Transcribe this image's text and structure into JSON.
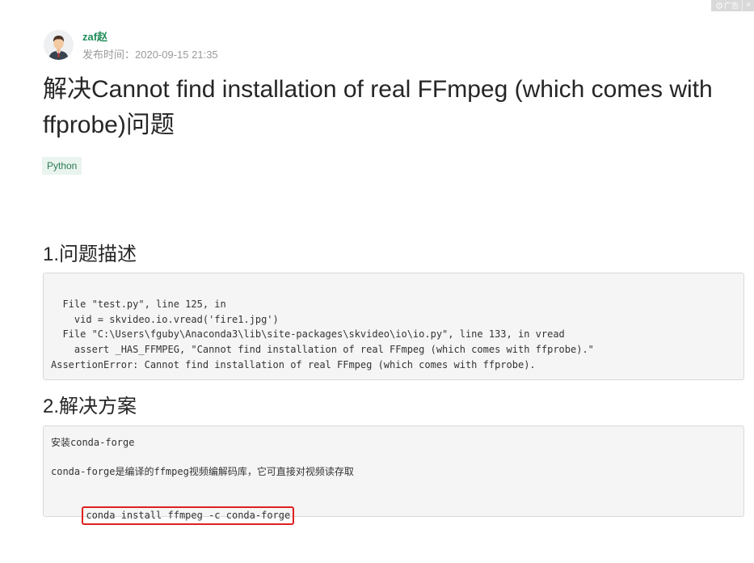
{
  "ad": {
    "label": "广告",
    "close": "×"
  },
  "author": {
    "name": "zaf赵",
    "publish_label": "发布时间：",
    "publish_time": "2020-09-15 21:35"
  },
  "article": {
    "title": "解决Cannot find installation of real FFmpeg (which comes with ffprobe)问题",
    "tag": "Python"
  },
  "sections": [
    {
      "heading": "1.问题描述",
      "code_lines": [
        "  File \"test.py\", line 125, in",
        "    vid = skvideo.io.vread('fire1.jpg')",
        "  File \"C:\\Users\\fguby\\Anaconda3\\lib\\site-packages\\skvideo\\io\\io.py\", line 133, in vread",
        "    assert _HAS_FFMPEG, \"Cannot find installation of real FFmpeg (which comes with ffprobe).\"",
        "AssertionError: Cannot find installation of real FFmpeg (which comes with ffprobe)."
      ]
    },
    {
      "heading": "2.解决方案",
      "lines": [
        "安装conda-forge",
        "conda-forge是编译的ffmpeg视频编解码库，它可直接对视频读存取",
        "conda install ffmpeg -c conda-forge"
      ]
    }
  ],
  "colors": {
    "author_name": "#1f8c58",
    "tag_bg": "#eaf4ef",
    "tag_text": "#2a7a52",
    "highlight_border": "#e02020",
    "code_bg": "#f5f5f5"
  }
}
